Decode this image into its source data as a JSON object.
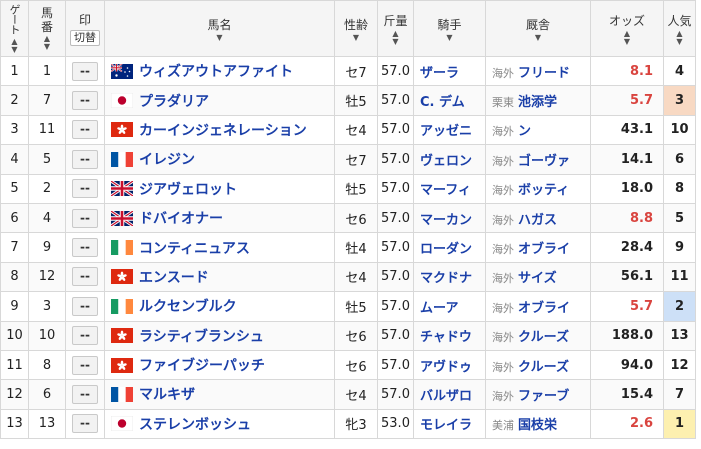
{
  "header": {
    "gate": "ゲート",
    "umaban_l1": "馬",
    "umaban_l2": "番",
    "mark_label": "印",
    "mark_toggle": "切替",
    "horse_name": "馬名",
    "sex_age": "性齢",
    "weight": "斤量",
    "jockey": "騎手",
    "trainer": "厩舎",
    "odds": "オッズ",
    "popularity": "人気"
  },
  "mark_placeholder": "--",
  "colors": {
    "link": "#1a3fa8",
    "odds_hot": "#d9443f",
    "pop1_bg": "#fdf0b0",
    "pop2_bg": "#cde0f7",
    "pop3_bg": "#f8d9c3"
  },
  "rows": [
    {
      "gate": "1",
      "num": "1",
      "flag": "australia",
      "name": "ウィズアウトアファイト",
      "sexage": "セ7",
      "weight": "57.0",
      "jockey": "ザーラ",
      "region": "海外",
      "trainer": "フリード",
      "odds": "8.1",
      "hot": true,
      "pop": "4"
    },
    {
      "gate": "2",
      "num": "7",
      "flag": "japan",
      "name": "プラダリア",
      "sexage": "牡5",
      "weight": "57.0",
      "jockey": "C. デム",
      "region": "栗東",
      "trainer": "池添学",
      "odds": "5.7",
      "hot": true,
      "pop": "3"
    },
    {
      "gate": "3",
      "num": "11",
      "flag": "hongkong",
      "name": "カーインジェネレーション",
      "sexage": "セ4",
      "weight": "57.0",
      "jockey": "アッゼニ",
      "region": "海外",
      "trainer": "ン",
      "odds": "43.1",
      "hot": false,
      "pop": "10"
    },
    {
      "gate": "4",
      "num": "5",
      "flag": "france",
      "name": "イレジン",
      "sexage": "セ7",
      "weight": "57.0",
      "jockey": "ヴェロン",
      "region": "海外",
      "trainer": "ゴーヴァ",
      "odds": "14.1",
      "hot": false,
      "pop": "6"
    },
    {
      "gate": "5",
      "num": "2",
      "flag": "uk",
      "name": "ジアヴェロット",
      "sexage": "牡5",
      "weight": "57.0",
      "jockey": "マーフィ",
      "region": "海外",
      "trainer": "ボッティ",
      "odds": "18.0",
      "hot": false,
      "pop": "8"
    },
    {
      "gate": "6",
      "num": "4",
      "flag": "uk",
      "name": "ドバイオナー",
      "sexage": "セ6",
      "weight": "57.0",
      "jockey": "マーカン",
      "region": "海外",
      "trainer": "ハガス",
      "odds": "8.8",
      "hot": true,
      "pop": "5"
    },
    {
      "gate": "7",
      "num": "9",
      "flag": "ireland",
      "name": "コンティニュアス",
      "sexage": "牡4",
      "weight": "57.0",
      "jockey": "ローダン",
      "region": "海外",
      "trainer": "オブライ",
      "odds": "28.4",
      "hot": false,
      "pop": "9"
    },
    {
      "gate": "8",
      "num": "12",
      "flag": "hongkong",
      "name": "エンスード",
      "sexage": "セ4",
      "weight": "57.0",
      "jockey": "マクドナ",
      "region": "海外",
      "trainer": "サイズ",
      "odds": "56.1",
      "hot": false,
      "pop": "11"
    },
    {
      "gate": "9",
      "num": "3",
      "flag": "ireland",
      "name": "ルクセンブルク",
      "sexage": "牡5",
      "weight": "57.0",
      "jockey": "ムーア",
      "region": "海外",
      "trainer": "オブライ",
      "odds": "5.7",
      "hot": true,
      "pop": "2"
    },
    {
      "gate": "10",
      "num": "10",
      "flag": "hongkong",
      "name": "ラシティブランシュ",
      "sexage": "セ6",
      "weight": "57.0",
      "jockey": "チャドウ",
      "region": "海外",
      "trainer": "クルーズ",
      "odds": "188.0",
      "hot": false,
      "pop": "13"
    },
    {
      "gate": "11",
      "num": "8",
      "flag": "hongkong",
      "name": "ファイブジーパッチ",
      "sexage": "セ6",
      "weight": "57.0",
      "jockey": "アヴドゥ",
      "region": "海外",
      "trainer": "クルーズ",
      "odds": "94.0",
      "hot": false,
      "pop": "12"
    },
    {
      "gate": "12",
      "num": "6",
      "flag": "france",
      "name": "マルキザ",
      "sexage": "セ4",
      "weight": "57.0",
      "jockey": "バルザロ",
      "region": "海外",
      "trainer": "ファーブ",
      "odds": "15.4",
      "hot": false,
      "pop": "7"
    },
    {
      "gate": "13",
      "num": "13",
      "flag": "japan",
      "name": "ステレンボッシュ",
      "sexage": "牝3",
      "weight": "53.0",
      "jockey": "モレイラ",
      "region": "美浦",
      "trainer": "国枝栄",
      "odds": "2.6",
      "hot": true,
      "pop": "1"
    }
  ]
}
